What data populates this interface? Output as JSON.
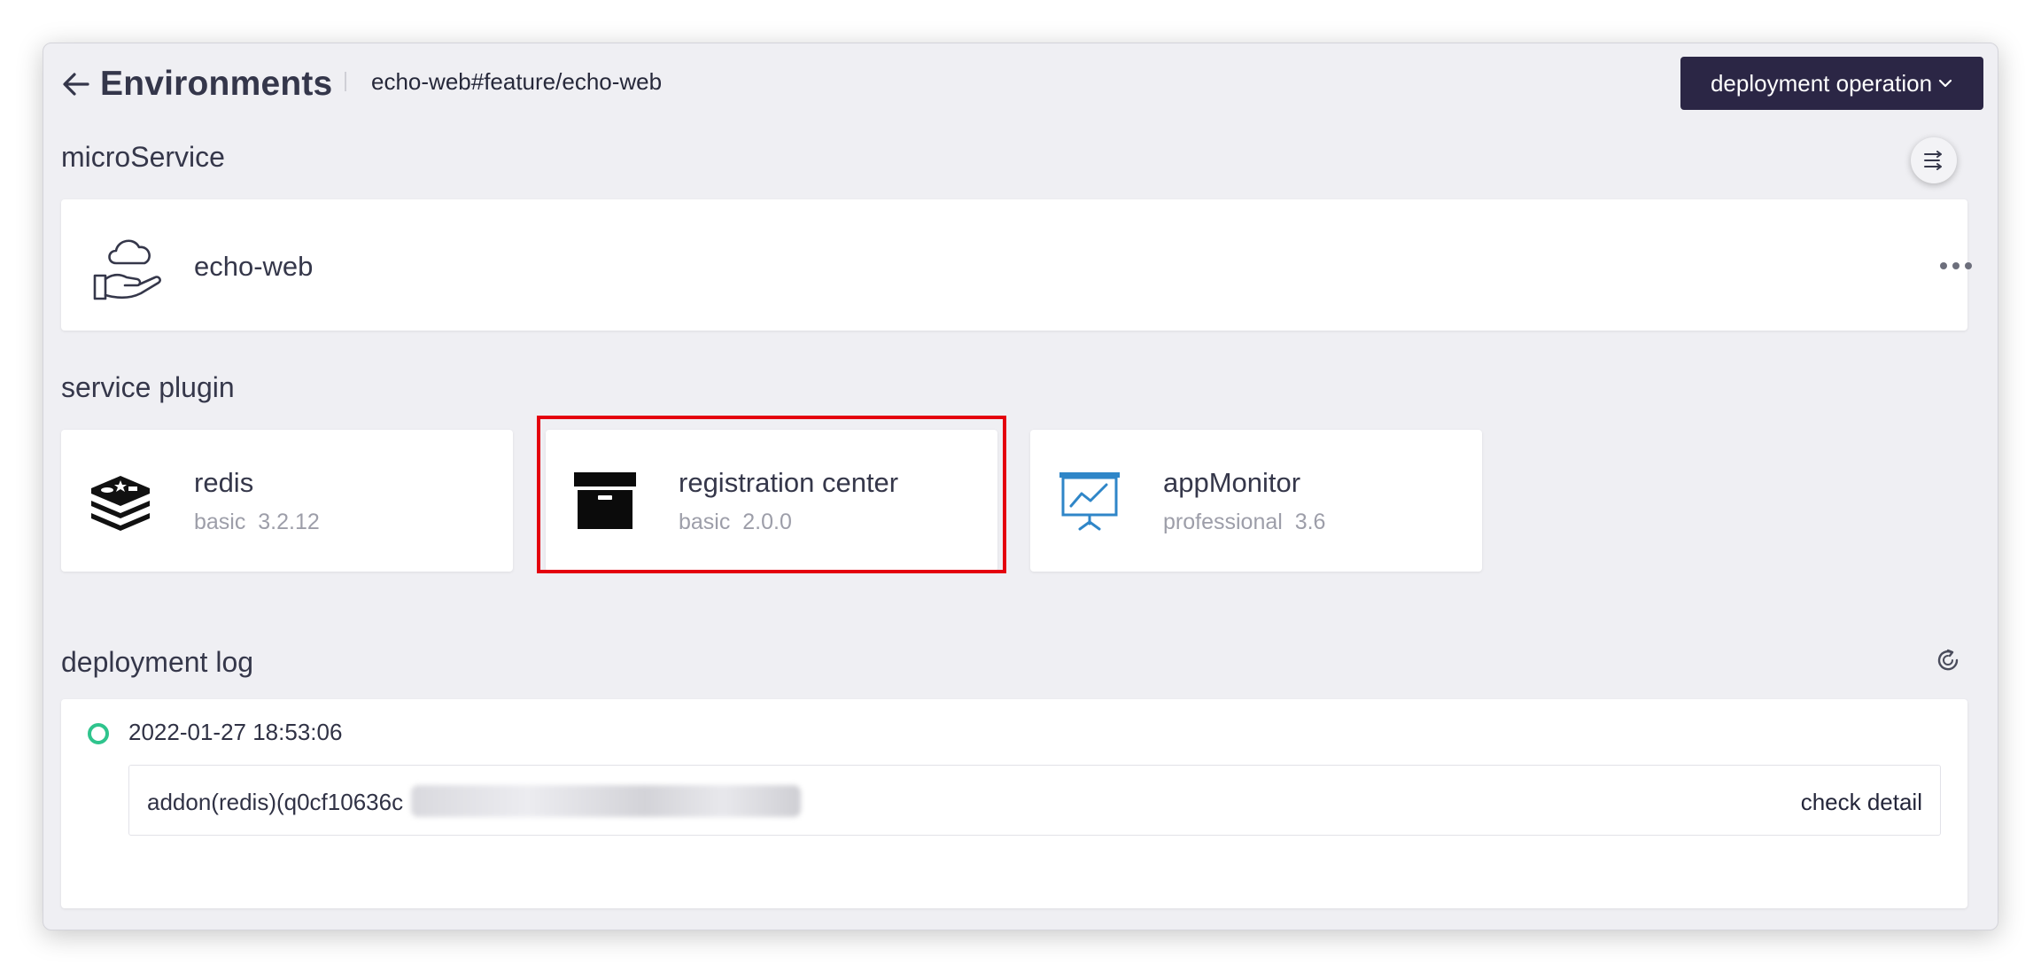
{
  "header": {
    "title": "Environments",
    "branch": "echo-web#feature/echo-web",
    "deploy_button_label": "deployment operation"
  },
  "microservice": {
    "section_title": "microService",
    "service_name": "echo-web"
  },
  "service_plugin": {
    "section_title": "service plugin",
    "plugins": [
      {
        "name": "redis",
        "meta": "basic  3.2.12",
        "icon": "redis-icon"
      },
      {
        "name": "registration center",
        "meta": "basic  2.0.0",
        "icon": "archive-box-icon"
      },
      {
        "name": "appMonitor",
        "meta": "professional  3.6",
        "icon": "monitor-chart-icon"
      }
    ]
  },
  "deployment_log": {
    "section_title": "deployment log",
    "entries": [
      {
        "time": "2022-01-27 18:53:06",
        "text": "addon(redis)(q0cf10636c",
        "action": "check detail"
      }
    ]
  },
  "colors": {
    "primary_dark": "#2b2645",
    "highlight": "#e4000e",
    "success": "#2fc48d",
    "monitor_blue": "#2f86c8"
  }
}
